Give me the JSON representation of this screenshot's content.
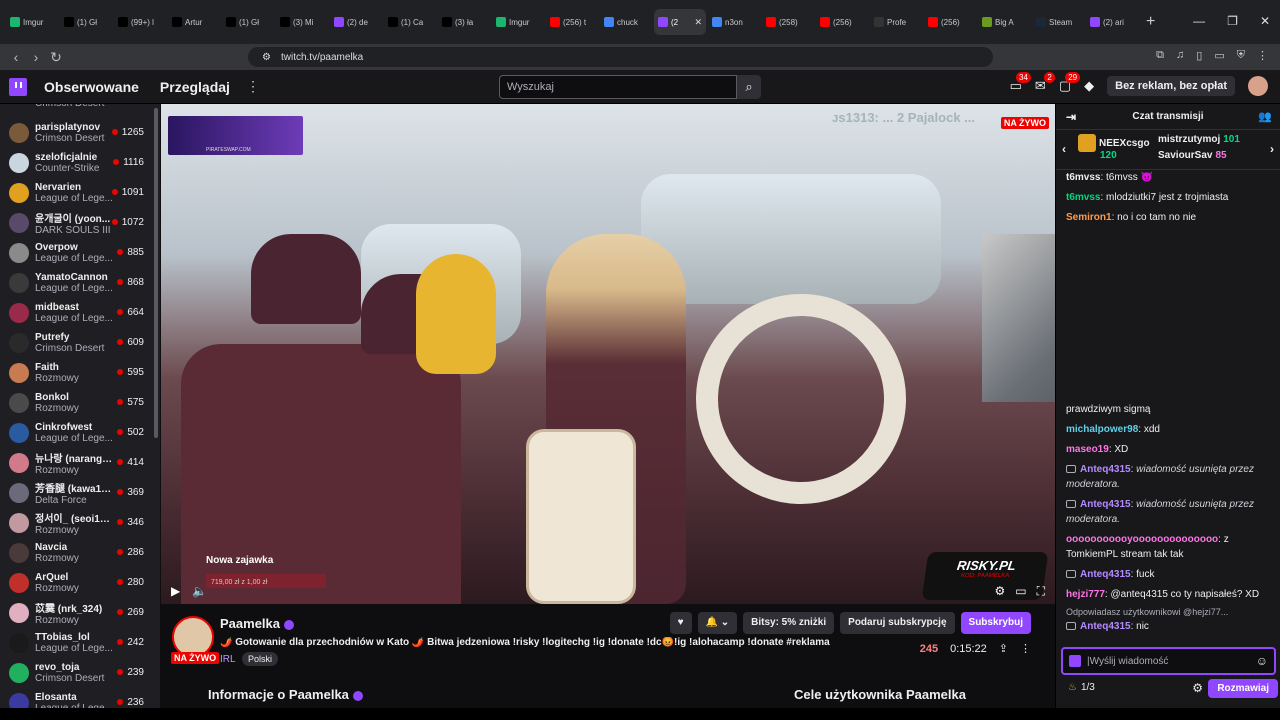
{
  "browser": {
    "tabs": [
      {
        "label": "Imgur",
        "color": "#1bb76e"
      },
      {
        "label": "(1) Gł",
        "color": "#000000"
      },
      {
        "label": "(99+) l",
        "color": "#000000"
      },
      {
        "label": "Artur",
        "color": "#000000"
      },
      {
        "label": "(1) Gł",
        "color": "#000000"
      },
      {
        "label": "(3) Mi",
        "color": "#000000"
      },
      {
        "label": "(2) de",
        "color": "#9147ff"
      },
      {
        "label": "(1) Ca",
        "color": "#000000"
      },
      {
        "label": "(3) ła",
        "color": "#000000"
      },
      {
        "label": "Imgur",
        "color": "#1bb76e"
      },
      {
        "label": "(256) t",
        "color": "#ff0000"
      },
      {
        "label": "chuck",
        "color": "#4285f4"
      },
      {
        "label": "(2",
        "color": "#9147ff",
        "active": true
      },
      {
        "label": "n3on",
        "color": "#4285f4"
      },
      {
        "label": "(258)",
        "color": "#ff0000"
      },
      {
        "label": "(256)",
        "color": "#ff0000"
      },
      {
        "label": "Profe",
        "color": "#333333"
      },
      {
        "label": "(256)",
        "color": "#ff0000"
      },
      {
        "label": "Big A",
        "color": "#6a9a1f"
      },
      {
        "label": "Steam",
        "color": "#1b2838"
      },
      {
        "label": "(2) ari",
        "color": "#9147ff"
      }
    ],
    "url": "twitch.tv/paamelka"
  },
  "topnav": {
    "following": "Obserwowane",
    "browse": "Przeglądaj",
    "search_placeholder": "Wyszukaj",
    "badge_inbox": "34",
    "badge_whispers": "2",
    "badge_notifications": "29",
    "no_ads": "Bez reklam, bez opłat"
  },
  "sidebar": {
    "partial_top": "Crimson Desert",
    "channels": [
      {
        "name": "parisplatynov",
        "game": "Crimson Desert",
        "viewers": "1265",
        "color": "#7a5a3a"
      },
      {
        "name": "szeloficjalnie",
        "game": "Counter-Strike",
        "viewers": "1116",
        "color": "#c9d6e0"
      },
      {
        "name": "Nervarien",
        "game": "League of Lege...",
        "viewers": "1091",
        "color": "#e0a020"
      },
      {
        "name": "윤개굴이 (yoon...",
        "game": "DARK SOULS III",
        "viewers": "1072",
        "color": "#5a4a6a"
      },
      {
        "name": "Overpow",
        "game": "League of Lege...",
        "viewers": "885",
        "color": "#8a8a8a"
      },
      {
        "name": "YamatoCannon",
        "game": "League of Lege...",
        "viewers": "868",
        "color": "#3a3a3a"
      },
      {
        "name": "midbeast",
        "game": "League of Lege...",
        "viewers": "664",
        "color": "#9a2a4a"
      },
      {
        "name": "Putrefy",
        "game": "Crimson Desert",
        "viewers": "609",
        "color": "#2a2a2a"
      },
      {
        "name": "Faith",
        "game": "Rozmowy",
        "viewers": "595",
        "color": "#c87a50"
      },
      {
        "name": "Bonkol",
        "game": "Rozmowy",
        "viewers": "575",
        "color": "#4a4a4a"
      },
      {
        "name": "Cinkrofwest",
        "game": "League of Lege...",
        "viewers": "502",
        "color": "#2a5aa0"
      },
      {
        "name": "뉴나랑 (narang_...",
        "game": "Rozmowy",
        "viewers": "414",
        "color": "#d07a8a"
      },
      {
        "name": "芳香腿 (kawa1s...",
        "game": "Delta Force",
        "viewers": "369",
        "color": "#6a6a7a"
      },
      {
        "name": "정서이_ (seoi10...",
        "game": "Rozmowy",
        "viewers": "346",
        "color": "#c09aa0"
      },
      {
        "name": "Navcia",
        "game": "Rozmowy",
        "viewers": "286",
        "color": "#4a3a3a"
      },
      {
        "name": "ArQuel",
        "game": "Rozmowy",
        "viewers": "280",
        "color": "#c0302a"
      },
      {
        "name": "苡霙 (nrk_324)",
        "game": "Rozmowy",
        "viewers": "269",
        "color": "#e0b0c0"
      },
      {
        "name": "TTobias_lol",
        "game": "League of Lege...",
        "viewers": "242",
        "color": "#1a1a1a"
      },
      {
        "name": "revo_toja",
        "game": "Crimson Desert",
        "viewers": "239",
        "color": "#20b060"
      },
      {
        "name": "Elosanta",
        "game": "League of Lege...",
        "viewers": "236",
        "color": "#3a3aa0"
      }
    ]
  },
  "player": {
    "live_label": "NA ŻYWO",
    "ticker": "ᴊs1313: ... 2 Pajalock ...",
    "ad_text": "PIRATESWAP.COM",
    "overlay_title": "Nowa zajawka",
    "overlay_sub": "719,00 zł z 1,00 zł",
    "brand_logo": "RISKY.PL",
    "brand_sub": "KOD: PAAMELKA"
  },
  "channel": {
    "name": "Paamelka",
    "live_tag": "NA ŻYWO",
    "title": "🌶️ Gotowanie dla przechodniów w Kato 🌶️ Bitwa jedzeniowa !risky !logitechg !ig !donate !dc😡!ig !alohacamp !donate #reklama",
    "category": "IRL",
    "language": "Polski",
    "bits_label": "Bitsy: 5% zniżki",
    "gift_label": "Podaruj subskrypcję",
    "subscribe_label": "Subskrybuj",
    "viewers": "245",
    "uptime": "0:15:22",
    "about_title": "Informacje o Paamelka",
    "goals_title": "Cele użytkownika Paamelka"
  },
  "chat": {
    "header": "Czat transmisji",
    "leaderboard": [
      {
        "name": "NEEXcsgo",
        "value": "120"
      },
      {
        "name": "mistrzutymoj",
        "value": "101"
      },
      {
        "name": "SaviourSav",
        "value": "85"
      }
    ],
    "messages": [
      {
        "user": "t6mvss",
        "color": "#efeff1",
        "text": "t6mvss 😈"
      },
      {
        "user": "t6mvss",
        "color": "#00d67e",
        "text": "mlodziutki7 jest z trojmiasta"
      },
      {
        "user": "Semiron1",
        "color": "#ff9a4a",
        "text": "no i co tam no nie"
      }
    ],
    "messages_lower": [
      {
        "user": "",
        "color": "#efeff1",
        "text": "prawdziwym sigmą",
        "mod": false
      },
      {
        "user": "michalpower98",
        "color": "#5fd0e8",
        "text": "xdd",
        "mod": false
      },
      {
        "user": "maseo19",
        "color": "#ff75e6",
        "text": "XD",
        "mod": false
      },
      {
        "user": "Anteq4315",
        "color": "#b48bff",
        "text": "wiadomość usunięta przez moderatora.",
        "mod": true
      },
      {
        "user": "Anteq4315",
        "color": "#b48bff",
        "text": "wiadomość usunięta przez moderatora.",
        "mod": true
      },
      {
        "user": "ooooooooooyoooooooooooooo",
        "color": "#ff75e6",
        "text": "z TomkiemPL stream tak tak",
        "mod": false
      },
      {
        "user": "Anteq4315",
        "color": "#b48bff",
        "text": "fuck",
        "mod": true
      },
      {
        "user": "hejzi777",
        "color": "#ff75e6",
        "text": "@anteq4315 co ty napisałeś? XD",
        "mod": false
      }
    ],
    "reply_note": "Odpowiadasz użytkownikowi @hejzi77...",
    "last_msg": {
      "user": "Anteq4315",
      "color": "#b48bff",
      "text": "nic"
    },
    "input_placeholder": "|Wyślij wiadomość",
    "points": "1/3",
    "send_label": "Rozmawiaj"
  }
}
